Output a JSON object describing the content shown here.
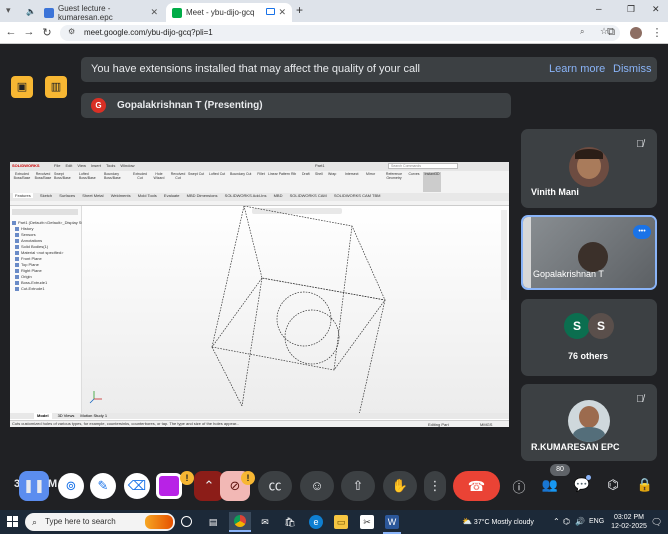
{
  "browser": {
    "tabs": [
      {
        "title": "Guest lecture - kumaresan.epc",
        "active": false
      },
      {
        "title": "Meet - ybu-dijo-gcq",
        "active": true
      }
    ],
    "new_tab": "+",
    "window_controls": {
      "minimize": "–",
      "maximize": "❐",
      "close": "✕"
    },
    "url": "meet.google.com/ybu-dijo-gcq?pli=1"
  },
  "meet": {
    "banner": {
      "text": "You have extensions installed that may affect the quality of your call",
      "learn_more": "Learn more",
      "dismiss": "Dismiss"
    },
    "presenter": {
      "initial": "G",
      "text": "Gopalakrishnan T (Presenting)"
    },
    "participants": [
      {
        "name": "Vinith Mani",
        "muted": true
      },
      {
        "name": "Gopalakrishnan T",
        "speaking": true
      },
      {
        "avatars": [
          "S",
          "S"
        ],
        "name": "76 others"
      },
      {
        "name": "R.KUMARESAN EPC",
        "muted": true
      }
    ],
    "controls": {
      "time_partial": "3",
      "name_partial": "M",
      "people_count": "80",
      "warning": "!"
    },
    "colors": {
      "accent_blue": "#8ab4f8",
      "end_call": "#ea4335",
      "warning": "#f7b733",
      "speaking_border": "#8ab4f8"
    }
  },
  "shared_screen": {
    "app_logo": "SOLIDWORKS",
    "menu": [
      "File",
      "Edit",
      "View",
      "Insert",
      "Tools",
      "Window"
    ],
    "part_name": "Part1",
    "search": "Search Commands",
    "feature_tabs": [
      "Features",
      "Sketch",
      "Surfaces",
      "Sheet Metal",
      "Weldments",
      "Mold Tools",
      "Evaluate",
      "MBD Dimensions",
      "SOLIDWORKS Add-Ins",
      "MBD",
      "SOLIDWORKS CAM",
      "SOLIDWORKS CAM TBM"
    ],
    "ribbon_tools": [
      "Extruded Boss/Base",
      "Revolved Boss/Base",
      "Swept Boss/Base",
      "Lofted Boss/Base",
      "Boundary Boss/Base",
      "Extruded Cut",
      "Hole Wizard",
      "Revolved Cut",
      "Swept Cut",
      "Lofted Cut",
      "Boundary Cut",
      "Fillet",
      "Linear Pattern",
      "Rib",
      "Draft",
      "Shell",
      "Wrap",
      "Intersect",
      "Mirror",
      "Reference Geometry",
      "Curves",
      "Instant3D"
    ],
    "tree": [
      "Part1 (Default<<Default>_Display State 1>)",
      "History",
      "Sensors",
      "Annotations",
      "Solid Bodies(1)",
      "Material <not specified>",
      "Front Plane",
      "Top Plane",
      "Right Plane",
      "Origin",
      "Boss-Extrude1",
      "Cut-Extrude1"
    ],
    "bottom_tabs": [
      "Model",
      "3D Views",
      "Motion Study 1"
    ],
    "status": "Cuts customized holes of various types, for example, countersinks, counterbores, or tap. The type and size of the holes appear...",
    "status_right": [
      "Editing Part",
      "MMGS"
    ]
  },
  "taskbar": {
    "search_placeholder": "Type here to search",
    "weather": "37°C  Mostly cloudy",
    "language": "ENG",
    "time": "03:02 PM",
    "date": "12-02-2025"
  }
}
